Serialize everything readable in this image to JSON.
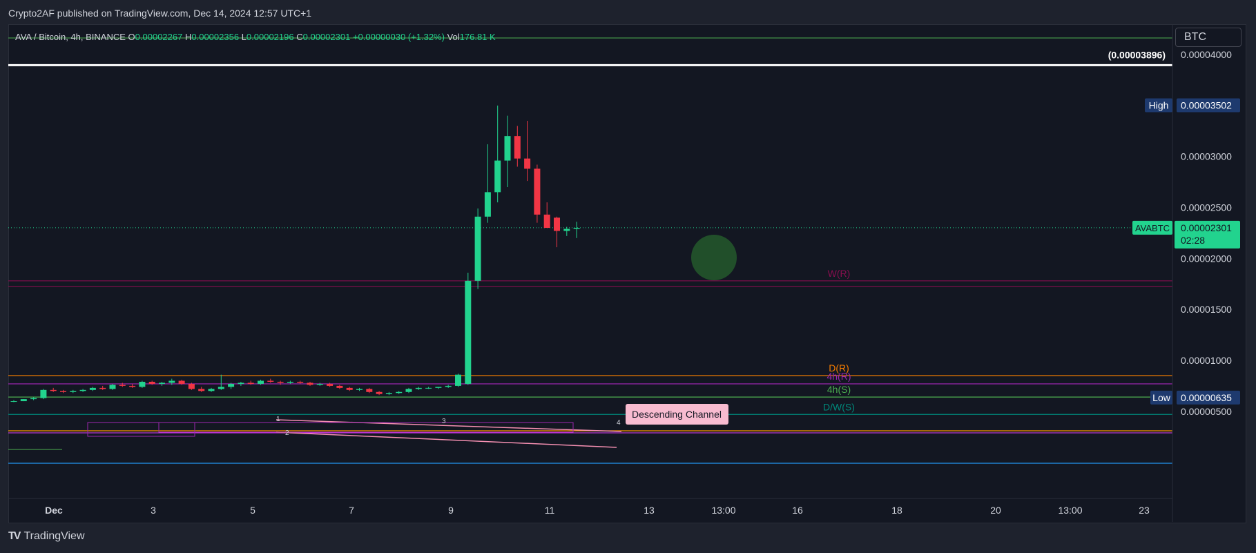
{
  "header": {
    "published": "Crypto2AF published on TradingView.com, Dec 14, 2024 12:57 UTC+1"
  },
  "legend": {
    "symbol": "AVA / Bitcoin, 4h, BINANCE",
    "o_label": "O",
    "o": "0.00002267",
    "h_label": "H",
    "h": "0.00002356",
    "l_label": "L",
    "l": "0.00002196",
    "c_label": "C",
    "c": "0.00002301",
    "change": "+0.00000030 (+1.32%)",
    "vol_label": "Vol",
    "vol": "176.81 K"
  },
  "currency": "BTC",
  "footer": {
    "brand": "TradingView"
  },
  "colors": {
    "up": "#22d38e",
    "down": "#f23645",
    "bg": "#131722",
    "accent": "#2962ff"
  },
  "chart_data": {
    "type": "candlestick",
    "symbol": "AVABTC",
    "interval": "4h",
    "y_axis": {
      "ticks": [
        "0.00004000",
        "0.00003000",
        "0.00002500",
        "0.00002000",
        "0.00001500",
        "0.00001000",
        "0.00000500"
      ],
      "tick_values": [
        4e-05,
        3e-05,
        2.5e-05,
        2e-05,
        1.5e-05,
        1e-05,
        5e-06
      ],
      "ylim": [
        1.6e-06,
        4.2e-06
      ]
    },
    "x_axis": {
      "ticks": [
        "Dec",
        "3",
        "5",
        "7",
        "9",
        "11",
        "13",
        "13:00",
        "16",
        "18",
        "20",
        "13:00",
        "23"
      ]
    },
    "badges": {
      "high_label": "High",
      "high": "0.00003502",
      "low_label": "Low",
      "low": "0.00000635",
      "current_symbol": "AVABTC",
      "current": "0.00002301",
      "countdown": "02:28",
      "top_level": "(0.00003896)"
    },
    "levels": [
      {
        "label": "W(R)",
        "value": 1.78e-05,
        "color": "#880e4f"
      },
      {
        "label": "D(R)",
        "value": 8.5e-06,
        "color": "#f57c00"
      },
      {
        "label": "4h(R)",
        "value": 7.7e-06,
        "color": "#9c27b0"
      },
      {
        "label": "4h(S)",
        "value": 6.4e-06,
        "color": "#4caf50"
      },
      {
        "label": "D/W(S)",
        "value": 4.7e-06,
        "color": "#00897b"
      }
    ],
    "annotation": "Descending Channel",
    "channel_points": [
      "1",
      "2",
      "3",
      "4"
    ],
    "candles": [
      [
        6e-06,
        6.1e-06,
        5.9e-06,
        6e-06
      ],
      [
        6e-06,
        6.2e-06,
        6e-06,
        6.2e-06
      ],
      [
        6.2e-06,
        6.4e-06,
        6.1e-06,
        6.3e-06
      ],
      [
        6.3e-06,
        7.2e-06,
        6.2e-06,
        7.1e-06
      ],
      [
        7.1e-06,
        7.3e-06,
        6.9e-06,
        7e-06
      ],
      [
        7e-06,
        7.1e-06,
        6.8e-06,
        6.9e-06
      ],
      [
        6.9e-06,
        7.1e-06,
        6.8e-06,
        7e-06
      ],
      [
        7e-06,
        7.2e-06,
        6.9e-06,
        7.1e-06
      ],
      [
        7.1e-06,
        7.4e-06,
        7e-06,
        7.3e-06
      ],
      [
        7.3e-06,
        7.5e-06,
        7.1e-06,
        7.2e-06
      ],
      [
        7.2e-06,
        7.7e-06,
        7.1e-06,
        7.6e-06
      ],
      [
        7.6e-06,
        7.8e-06,
        7.4e-06,
        7.5e-06
      ],
      [
        7.5e-06,
        7.7e-06,
        7.3e-06,
        7.4e-06
      ],
      [
        7.4e-06,
        8e-06,
        7.3e-06,
        7.9e-06
      ],
      [
        7.9e-06,
        8e-06,
        7.6e-06,
        7.7e-06
      ],
      [
        7.7e-06,
        7.9e-06,
        7.5e-06,
        7.8e-06
      ],
      [
        7.8e-06,
        8.2e-06,
        7.6e-06,
        8e-06
      ],
      [
        8e-06,
        8.1e-06,
        7.6e-06,
        7.7e-06
      ],
      [
        7.7e-06,
        7.8e-06,
        7.1e-06,
        7.2e-06
      ],
      [
        7.2e-06,
        7.4e-06,
        6.9e-06,
        7e-06
      ],
      [
        7e-06,
        7.3e-06,
        6.9e-06,
        7.2e-06
      ],
      [
        7.2e-06,
        8.6e-06,
        7.1e-06,
        7.4e-06
      ],
      [
        7.4e-06,
        7.8e-06,
        7.2e-06,
        7.7e-06
      ],
      [
        7.7e-06,
        7.9e-06,
        7.5e-06,
        7.8e-06
      ],
      [
        7.8e-06,
        8e-06,
        7.6e-06,
        7.7e-06
      ],
      [
        7.7e-06,
        8.1e-06,
        7.6e-06,
        8e-06
      ],
      [
        8e-06,
        8.2e-06,
        7.8e-06,
        7.9e-06
      ],
      [
        7.9e-06,
        8e-06,
        7.6e-06,
        7.8e-06
      ],
      [
        7.8e-06,
        8e-06,
        7.7e-06,
        7.9e-06
      ],
      [
        7.9e-06,
        8e-06,
        7.7e-06,
        7.8e-06
      ],
      [
        7.8e-06,
        7.9e-06,
        7.5e-06,
        7.6e-06
      ],
      [
        7.6e-06,
        7.8e-06,
        7.5e-06,
        7.7e-06
      ],
      [
        7.7e-06,
        7.8e-06,
        7.4e-06,
        7.5e-06
      ],
      [
        7.5e-06,
        7.6e-06,
        7.2e-06,
        7.3e-06
      ],
      [
        7.3e-06,
        7.4e-06,
        7e-06,
        7.1e-06
      ],
      [
        7.1e-06,
        7.3e-06,
        7e-06,
        7.2e-06
      ],
      [
        7.2e-06,
        7.3e-06,
        6.8e-06,
        6.9e-06
      ],
      [
        6.9e-06,
        7e-06,
        6.6e-06,
        6.7e-06
      ],
      [
        6.7e-06,
        6.9e-06,
        6.6e-06,
        6.8e-06
      ],
      [
        6.8e-06,
        7e-06,
        6.7e-06,
        6.9e-06
      ],
      [
        6.9e-06,
        7.3e-06,
        6.8e-06,
        7.2e-06
      ],
      [
        7.2e-06,
        7.4e-06,
        7.1e-06,
        7.3e-06
      ],
      [
        7.3e-06,
        7.4e-06,
        7.2e-06,
        7.3e-06
      ],
      [
        7.3e-06,
        7.4e-06,
        7.2e-06,
        7.4e-06
      ],
      [
        7.4e-06,
        7.6e-06,
        7.3e-06,
        7.5e-06
      ],
      [
        7.5e-06,
        8.7e-06,
        7.4e-06,
        8.6e-06
      ],
      [
        7.7e-06,
        1.86e-05,
        7.6e-06,
        1.78e-05
      ],
      [
        1.78e-05,
        2.49e-05,
        1.7e-05,
        2.41e-05
      ],
      [
        2.41e-05,
        3.12e-05,
        2.35e-05,
        2.65e-05
      ],
      [
        2.65e-05,
        3.5e-05,
        2.55e-05,
        2.96e-05
      ],
      [
        2.96e-05,
        3.4e-05,
        2.7e-05,
        3.2e-05
      ],
      [
        3.2e-05,
        3.3e-05,
        2.9e-05,
        2.98e-05
      ],
      [
        2.98e-05,
        3.35e-05,
        2.76e-05,
        2.88e-05
      ],
      [
        2.88e-05,
        2.92e-05,
        2.35e-05,
        2.43e-05
      ],
      [
        2.43e-05,
        2.55e-05,
        2.3e-05,
        2.3e-05
      ],
      [
        2.4e-05,
        2.41e-05,
        2.11e-05,
        2.27e-05
      ],
      [
        2.27e-05,
        2.31e-05,
        2.22e-05,
        2.29e-05
      ],
      [
        2.29e-05,
        2.36e-05,
        2.2e-05,
        2.3e-05
      ]
    ]
  }
}
